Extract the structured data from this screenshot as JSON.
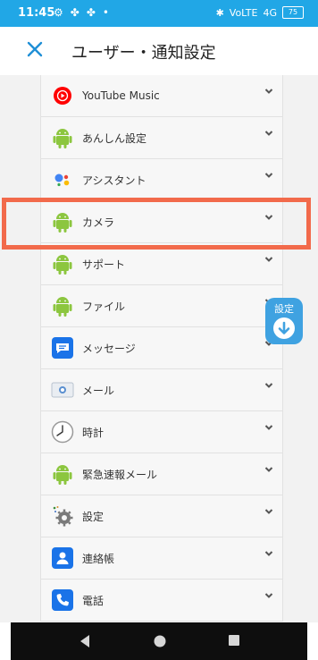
{
  "status_bar": {
    "time": "11:45",
    "network": "VoLTE",
    "signal": "4G",
    "battery": "75",
    "icons": [
      "settings-icon",
      "app-icon",
      "app-icon",
      "dot-icon"
    ]
  },
  "header": {
    "title": "ユーザー・通知設定",
    "close_icon": "close-icon"
  },
  "apps": [
    {
      "label": "YouTube Music",
      "icon": "youtube-music-icon"
    },
    {
      "label": "あんしん設定",
      "icon": "android-icon"
    },
    {
      "label": "アシスタント",
      "icon": "assistant-icon"
    },
    {
      "label": "カメラ",
      "icon": "android-icon"
    },
    {
      "label": "サポート",
      "icon": "android-icon"
    },
    {
      "label": "ファイル",
      "icon": "android-icon"
    },
    {
      "label": "メッセージ",
      "icon": "messages-icon"
    },
    {
      "label": "メール",
      "icon": "mail-icon"
    },
    {
      "label": "時計",
      "icon": "clock-icon"
    },
    {
      "label": "緊急速報メール",
      "icon": "android-icon"
    },
    {
      "label": "設定",
      "icon": "settings-gear-icon"
    },
    {
      "label": "連絡帳",
      "icon": "contacts-icon"
    },
    {
      "label": "電話",
      "icon": "phone-icon"
    }
  ],
  "fab": {
    "label": "設定"
  },
  "colors": {
    "status_bar": "#21a7e6",
    "accent": "#1f8fd6",
    "highlight": "#f26a4b",
    "android_green": "#8cc63f"
  }
}
